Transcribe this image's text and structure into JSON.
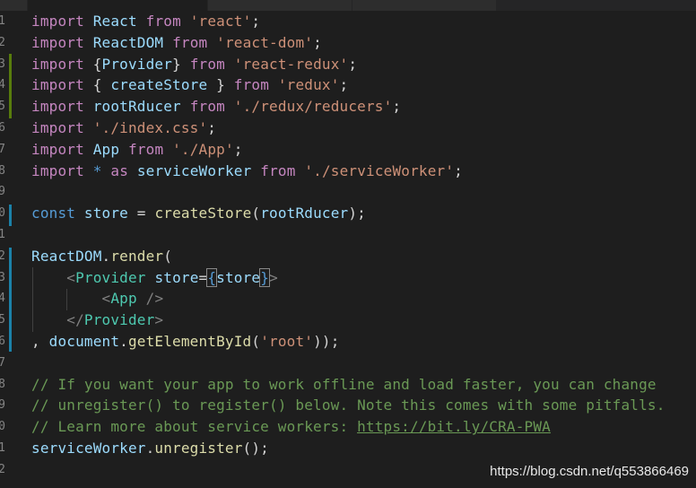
{
  "editor": {
    "lines": [
      {
        "num": "1",
        "tokens": [
          {
            "t": "import",
            "c": "t-kwp"
          },
          {
            "t": " "
          },
          {
            "t": "React",
            "c": "t-id"
          },
          {
            "t": " "
          },
          {
            "t": "from",
            "c": "t-kwp"
          },
          {
            "t": " "
          },
          {
            "t": "'react'",
            "c": "t-str"
          },
          {
            "t": ";"
          }
        ]
      },
      {
        "num": "2",
        "tokens": [
          {
            "t": "import",
            "c": "t-kwp"
          },
          {
            "t": " "
          },
          {
            "t": "ReactDOM",
            "c": "t-id"
          },
          {
            "t": " "
          },
          {
            "t": "from",
            "c": "t-kwp"
          },
          {
            "t": " "
          },
          {
            "t": "'react-dom'",
            "c": "t-str"
          },
          {
            "t": ";"
          }
        ]
      },
      {
        "num": "3",
        "tokens": [
          {
            "t": "import",
            "c": "t-kwp"
          },
          {
            "t": " {"
          },
          {
            "t": "Provider",
            "c": "t-id"
          },
          {
            "t": "} "
          },
          {
            "t": "from",
            "c": "t-kwp"
          },
          {
            "t": " "
          },
          {
            "t": "'react-redux'",
            "c": "t-str"
          },
          {
            "t": ";"
          }
        ]
      },
      {
        "num": "4",
        "tokens": [
          {
            "t": "import",
            "c": "t-kwp"
          },
          {
            "t": " { "
          },
          {
            "t": "createStore",
            "c": "t-id"
          },
          {
            "t": " } "
          },
          {
            "t": "from",
            "c": "t-kwp"
          },
          {
            "t": " "
          },
          {
            "t": "'redux'",
            "c": "t-str"
          },
          {
            "t": ";"
          }
        ]
      },
      {
        "num": "5",
        "tokens": [
          {
            "t": "import",
            "c": "t-kwp"
          },
          {
            "t": " "
          },
          {
            "t": "rootRducer",
            "c": "t-id"
          },
          {
            "t": " "
          },
          {
            "t": "from",
            "c": "t-kwp"
          },
          {
            "t": " "
          },
          {
            "t": "'./redux/reducers'",
            "c": "t-str"
          },
          {
            "t": ";"
          }
        ]
      },
      {
        "num": "6",
        "tokens": [
          {
            "t": "import",
            "c": "t-kwp"
          },
          {
            "t": " "
          },
          {
            "t": "'./index.css'",
            "c": "t-str"
          },
          {
            "t": ";"
          }
        ]
      },
      {
        "num": "7",
        "tokens": [
          {
            "t": "import",
            "c": "t-kwp"
          },
          {
            "t": " "
          },
          {
            "t": "App",
            "c": "t-id"
          },
          {
            "t": " "
          },
          {
            "t": "from",
            "c": "t-kwp"
          },
          {
            "t": " "
          },
          {
            "t": "'./App'",
            "c": "t-str"
          },
          {
            "t": ";"
          }
        ]
      },
      {
        "num": "8",
        "tokens": [
          {
            "t": "import",
            "c": "t-kwp"
          },
          {
            "t": " "
          },
          {
            "t": "*",
            "c": "t-kw"
          },
          {
            "t": " "
          },
          {
            "t": "as",
            "c": "t-kwp"
          },
          {
            "t": " "
          },
          {
            "t": "serviceWorker",
            "c": "t-id"
          },
          {
            "t": " "
          },
          {
            "t": "from",
            "c": "t-kwp"
          },
          {
            "t": " "
          },
          {
            "t": "'./serviceWorker'",
            "c": "t-str"
          },
          {
            "t": ";"
          }
        ]
      },
      {
        "num": "9",
        "tokens": []
      },
      {
        "num": "0",
        "tokens": [
          {
            "t": "const",
            "c": "t-kw"
          },
          {
            "t": " "
          },
          {
            "t": "store",
            "c": "t-id"
          },
          {
            "t": " = "
          },
          {
            "t": "createStore",
            "c": "t-fn"
          },
          {
            "t": "("
          },
          {
            "t": "rootRducer",
            "c": "t-id"
          },
          {
            "t": ");"
          }
        ]
      },
      {
        "num": "1",
        "tokens": []
      },
      {
        "num": "2",
        "tokens": [
          {
            "t": "ReactDOM",
            "c": "t-id"
          },
          {
            "t": "."
          },
          {
            "t": "render",
            "c": "t-fn"
          },
          {
            "t": "("
          }
        ]
      },
      {
        "num": "3",
        "tokens": [
          {
            "t": "    "
          },
          {
            "t": "<",
            "c": "t-tag"
          },
          {
            "t": "Provider",
            "c": "t-cls"
          },
          {
            "t": " "
          },
          {
            "t": "store",
            "c": "t-id"
          },
          {
            "t": "="
          },
          {
            "t": "{",
            "c": "t-kw t-br"
          },
          {
            "t": "store",
            "c": "t-id"
          },
          {
            "t": "}",
            "c": "t-kw t-br"
          },
          {
            "t": ">",
            "c": "t-tag"
          }
        ]
      },
      {
        "num": "4",
        "tokens": [
          {
            "t": "        "
          },
          {
            "t": "<",
            "c": "t-tag"
          },
          {
            "t": "App",
            "c": "t-cls"
          },
          {
            "t": " "
          },
          {
            "t": "/>",
            "c": "t-tag"
          }
        ]
      },
      {
        "num": "5",
        "tokens": [
          {
            "t": "    "
          },
          {
            "t": "</",
            "c": "t-tag"
          },
          {
            "t": "Provider",
            "c": "t-cls"
          },
          {
            "t": ">",
            "c": "t-tag"
          }
        ]
      },
      {
        "num": "6",
        "tokens": [
          {
            "t": ", "
          },
          {
            "t": "document",
            "c": "t-id"
          },
          {
            "t": "."
          },
          {
            "t": "getElementById",
            "c": "t-fn"
          },
          {
            "t": "("
          },
          {
            "t": "'root'",
            "c": "t-str"
          },
          {
            "t": "));"
          }
        ]
      },
      {
        "num": "7",
        "tokens": []
      },
      {
        "num": "8",
        "tokens": [
          {
            "t": "// If you want your app to work offline and load faster, you can change",
            "c": "t-cm"
          }
        ]
      },
      {
        "num": "9",
        "tokens": [
          {
            "t": "// unregister() to register() below. Note this comes with some pitfalls.",
            "c": "t-cm"
          }
        ]
      },
      {
        "num": "0",
        "tokens": [
          {
            "t": "// Learn more about service workers: ",
            "c": "t-cm"
          },
          {
            "t": "https://bit.ly/CRA-PWA",
            "c": "t-link"
          }
        ]
      },
      {
        "num": "1",
        "tokens": [
          {
            "t": "serviceWorker",
            "c": "t-id"
          },
          {
            "t": "."
          },
          {
            "t": "unregister",
            "c": "t-fn"
          },
          {
            "t": "();"
          }
        ]
      },
      {
        "num": "2",
        "tokens": []
      }
    ]
  },
  "watermark": "https://blog.csdn.net/q553866469",
  "colors": {
    "background": "#1e1e1e",
    "keyword": "#569cd6",
    "control_keyword": "#c586c0",
    "identifier": "#9cdcfe",
    "function": "#dcdcaa",
    "string": "#ce9178",
    "component": "#4ec9b0",
    "comment": "#6a9955",
    "added_marker": "#587c0c",
    "modified_marker": "#1b81a8"
  }
}
